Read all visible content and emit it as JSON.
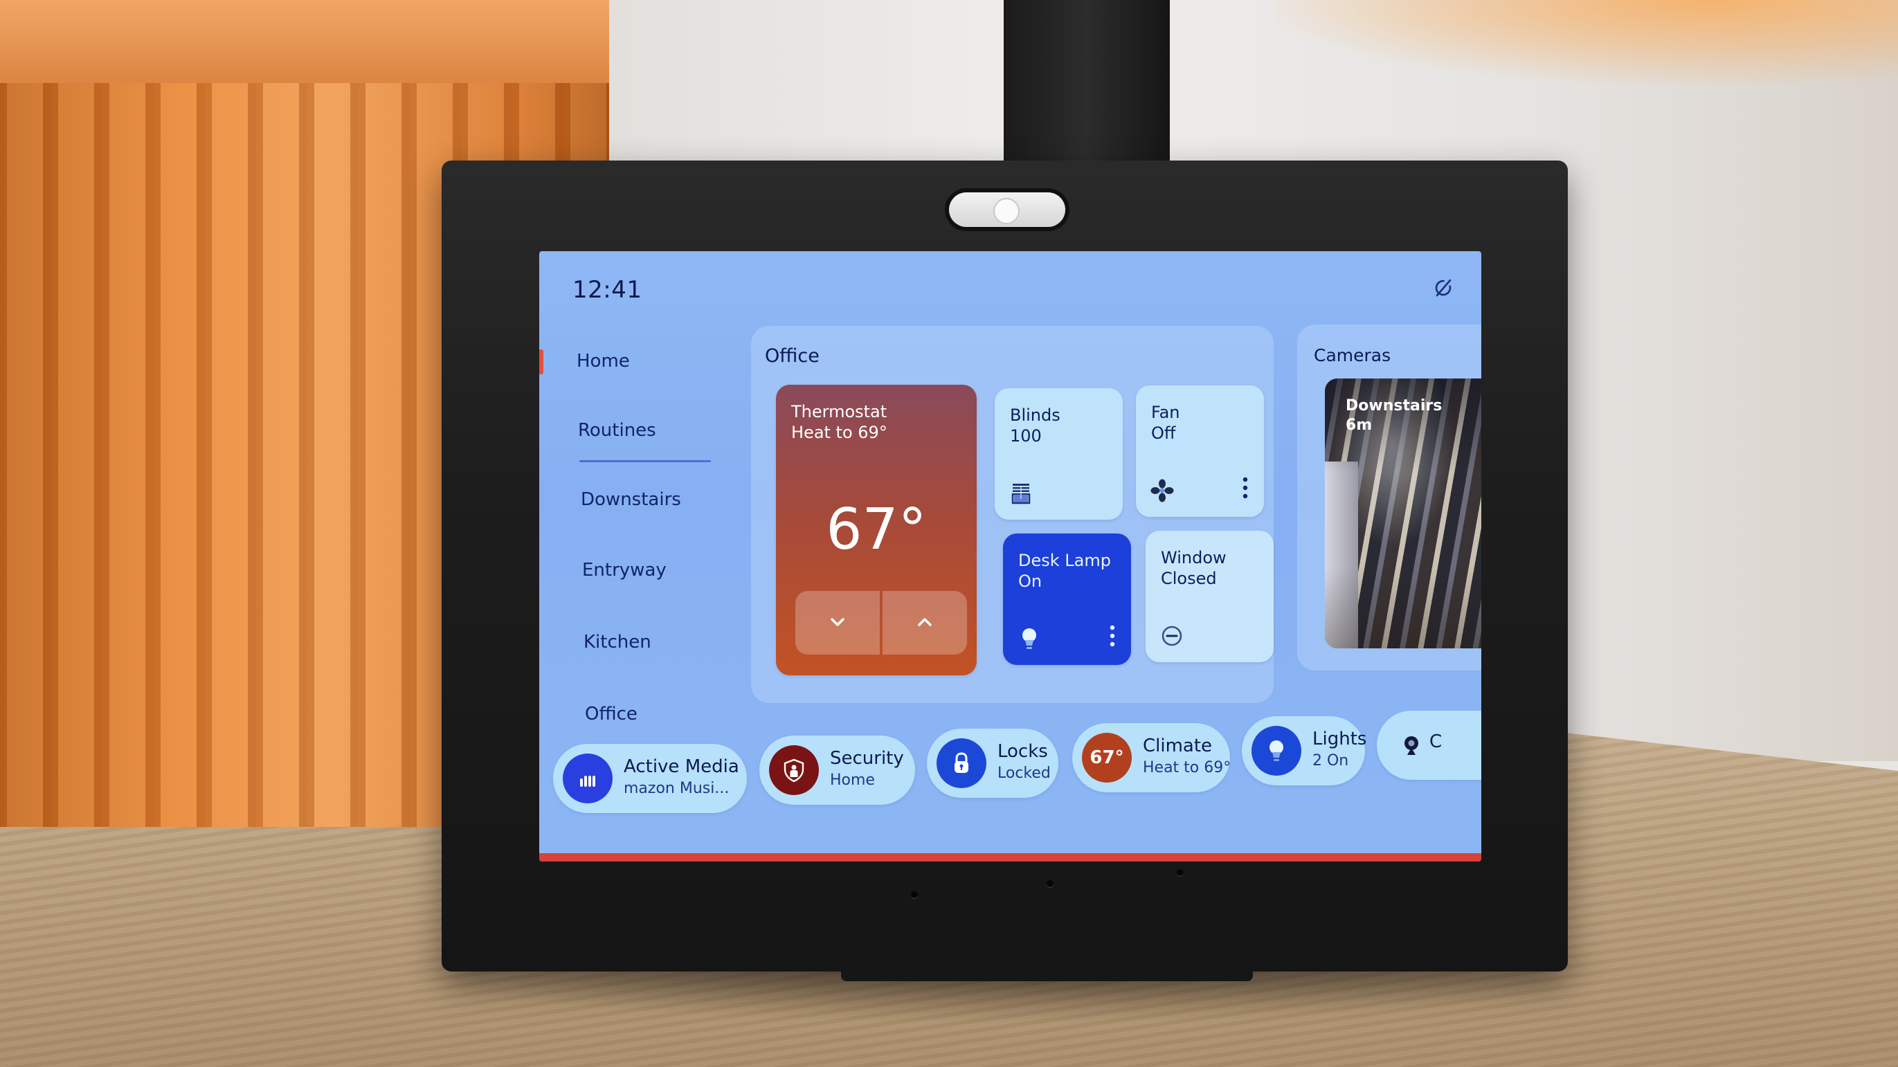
{
  "status_bar": {
    "time": "12:41",
    "dnd_icon": "do-not-disturb-icon"
  },
  "sidebar": {
    "active_index": 0,
    "items": [
      {
        "label": "Home"
      },
      {
        "label": "Routines"
      },
      {
        "label": "Downstairs"
      },
      {
        "label": "Entryway"
      },
      {
        "label": "Kitchen"
      },
      {
        "label": "Office"
      }
    ]
  },
  "office_group": {
    "title": "Office",
    "thermostat": {
      "name": "Thermostat",
      "state": "Heat to 69°",
      "current_temp": "67°",
      "decrease_icon": "chevron-down-icon",
      "increase_icon": "chevron-up-icon",
      "color": "#b84e2e"
    },
    "tiles": [
      {
        "name": "Blinds",
        "state": "100",
        "icon": "blinds-icon"
      },
      {
        "name": "Fan",
        "state": "Off",
        "icon": "fan-icon",
        "has_menu": true
      },
      {
        "name": "Desk Lamp",
        "state": "On",
        "icon": "lightbulb-icon",
        "has_menu": true,
        "active": true,
        "color": "#1c40d9"
      },
      {
        "name": "Window",
        "state": "Closed",
        "icon": "minus-circle-icon"
      }
    ]
  },
  "cameras_group": {
    "title": "Cameras",
    "feeds": [
      {
        "name": "Downstairs",
        "age": "6m"
      }
    ]
  },
  "quick_bar": {
    "pills": [
      {
        "title": "Active Media",
        "subtitle": "mazon Musi...",
        "icon": "equalizer-icon",
        "color": "#2a3fe0"
      },
      {
        "title": "Security",
        "subtitle": "Home",
        "icon": "shield-person-icon",
        "color": "#7a1414"
      },
      {
        "title": "Locks",
        "subtitle": "Locked",
        "icon": "padlock-icon",
        "color": "#1c48d8"
      },
      {
        "title": "Climate",
        "subtitle": "Heat to 69°",
        "badge": "67°",
        "color": "#b2401f"
      },
      {
        "title": "Lights",
        "subtitle": "2 On",
        "icon": "lightbulb-icon",
        "color": "#1c48d8"
      },
      {
        "title": "C",
        "subtitle": "",
        "icon": "webcam-icon"
      }
    ]
  },
  "colors": {
    "screen_bg": "#8cb4f3",
    "accent_red": "#e1503e",
    "tile_bg": "#bfe3fb",
    "text_dark": "#0d1f5c"
  }
}
